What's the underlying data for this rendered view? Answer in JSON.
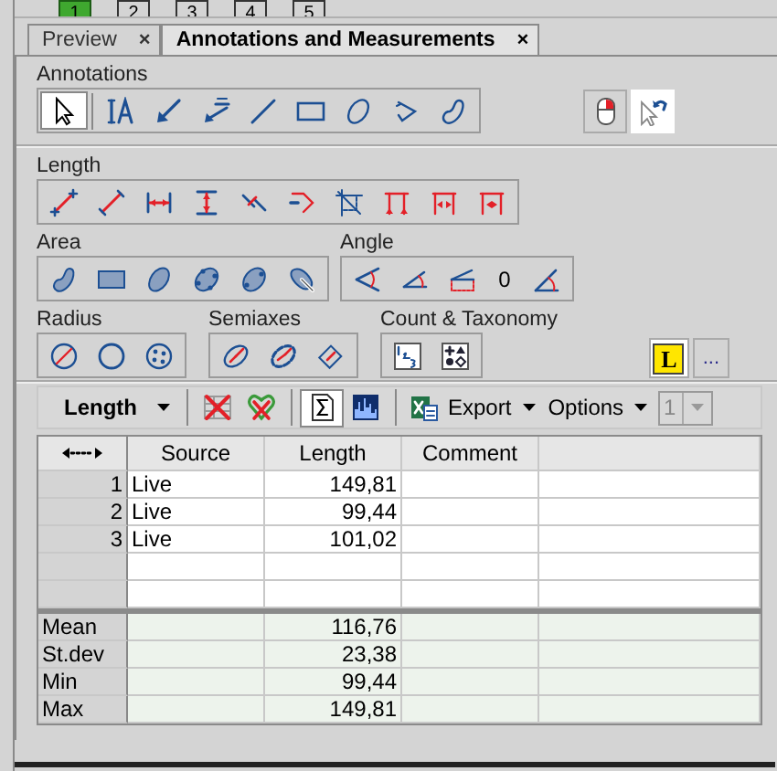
{
  "page_buttons": [
    {
      "label": "1",
      "selected": true
    },
    {
      "label": "2",
      "selected": false
    },
    {
      "label": "3",
      "selected": false
    },
    {
      "label": "4",
      "selected": false
    },
    {
      "label": "5",
      "selected": false
    }
  ],
  "doc_tabs": [
    {
      "label": "Preview",
      "close": "×",
      "selected": false
    },
    {
      "label": "Annotations and Measurements",
      "close": "×",
      "selected": true
    }
  ],
  "annotations": {
    "label": "Annotations",
    "tools": [
      {
        "selected": true
      },
      {
        "selected": false
      },
      {
        "selected": false
      },
      {
        "selected": false
      },
      {
        "selected": false
      },
      {
        "selected": false
      },
      {
        "selected": false
      },
      {
        "selected": false
      },
      {
        "selected": false
      }
    ],
    "mode_buttons": [
      {
        "selected": false
      },
      {
        "selected": true
      }
    ]
  },
  "groups": [
    {
      "label": "Length",
      "tools": [
        {
          "kind": "icon",
          "selected": false
        },
        {
          "kind": "icon",
          "selected": false
        },
        {
          "kind": "icon",
          "selected": false
        },
        {
          "kind": "icon",
          "selected": false
        },
        {
          "kind": "icon",
          "selected": false
        },
        {
          "kind": "icon",
          "selected": false
        },
        {
          "kind": "icon",
          "selected": false
        },
        {
          "kind": "icon",
          "selected": false
        },
        {
          "kind": "icon",
          "selected": false
        },
        {
          "kind": "icon",
          "selected": false
        }
      ]
    },
    {
      "label": "Area",
      "tools": [
        {
          "kind": "icon",
          "selected": false
        },
        {
          "kind": "icon",
          "selected": false
        },
        {
          "kind": "icon",
          "selected": false
        },
        {
          "kind": "icon",
          "selected": false
        },
        {
          "kind": "icon",
          "selected": false
        },
        {
          "kind": "icon",
          "selected": false
        }
      ]
    },
    {
      "label": "Angle",
      "tools": [
        {
          "kind": "icon",
          "selected": false
        },
        {
          "kind": "icon",
          "selected": false
        },
        {
          "kind": "icon",
          "selected": false
        },
        {
          "kind": "text",
          "text": "0"
        },
        {
          "kind": "icon",
          "selected": false
        }
      ]
    },
    {
      "label": "Radius",
      "tools": [
        {
          "kind": "icon",
          "selected": false
        },
        {
          "kind": "icon",
          "selected": false
        },
        {
          "kind": "icon",
          "selected": false
        }
      ]
    },
    {
      "label": "Semiaxes",
      "tools": [
        {
          "kind": "icon",
          "selected": false
        },
        {
          "kind": "icon",
          "selected": false
        },
        {
          "kind": "icon",
          "selected": false
        }
      ]
    },
    {
      "label": "Count & Taxonomy",
      "tools": [
        {
          "kind": "icon",
          "selected": false
        },
        {
          "kind": "icon",
          "selected": false
        }
      ]
    }
  ],
  "extras": [
    {
      "kind": "legend",
      "text": "L",
      "selected": true
    },
    {
      "kind": "more",
      "text": "..."
    }
  ],
  "results_toolbar": {
    "measurement": "Length",
    "toggles": [
      {
        "selected": true
      },
      {
        "selected": false
      }
    ],
    "export": "Export",
    "options": "Options",
    "page": {
      "value": "1",
      "disabled": true
    }
  },
  "table": {
    "columns": [
      "Source",
      "Length",
      "Comment"
    ],
    "rows": [
      {
        "index": "1",
        "cells": [
          "Live",
          "149,81"
        ]
      },
      {
        "index": "2",
        "cells": [
          "Live",
          "99,44"
        ]
      },
      {
        "index": "3",
        "cells": [
          "Live",
          "101,02"
        ]
      }
    ],
    "stats": [
      {
        "label": "Mean",
        "value": "116,76"
      },
      {
        "label": "St.dev",
        "value": "23,38"
      },
      {
        "label": "Min",
        "value": "99,44"
      },
      {
        "label": "Max",
        "value": "149,81"
      }
    ]
  }
}
